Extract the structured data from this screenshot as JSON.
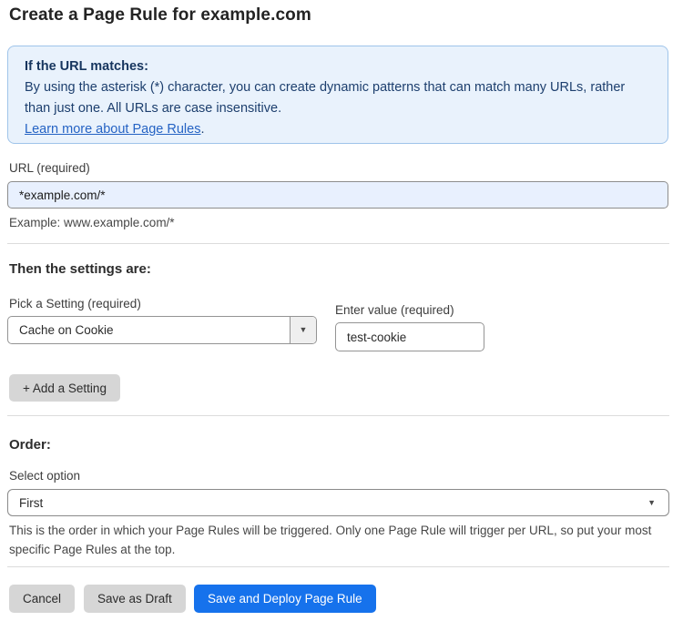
{
  "page": {
    "title": "Create a Page Rule for example.com"
  },
  "info_box": {
    "heading": "If the URL matches:",
    "body": "By using the asterisk (*) character, you can create dynamic patterns that can match many URLs, rather than just one. All URLs are case insensitive.",
    "link_text": "Learn more about Page Rules",
    "link_suffix": "."
  },
  "url_field": {
    "label": "URL (required)",
    "value": "*example.com/*",
    "example": "Example: www.example.com/*"
  },
  "settings_section": {
    "heading": "Then the settings are:",
    "setting_label": "Pick a Setting (required)",
    "setting_selected": "Cache on Cookie",
    "value_label": "Enter value (required)",
    "value_text": "test-cookie",
    "add_button_label": "+ Add a Setting"
  },
  "order_section": {
    "heading": "Order:",
    "select_label": "Select option",
    "selected": "First",
    "help": "This is the order in which your Page Rules will be triggered. Only one Page Rule will trigger per URL, so put your most specific Page Rules at the top."
  },
  "actions": {
    "cancel": "Cancel",
    "save_draft": "Save as Draft",
    "save_deploy": "Save and Deploy Page Rule"
  },
  "icons": {
    "dropdown_arrow": "▼"
  },
  "colors": {
    "primary_blue": "#1672ec",
    "info_bg": "#e9f2fc",
    "info_border": "#9fc4ea",
    "info_text": "#1d3f6e",
    "link_blue": "#2563c4",
    "autofill_input_bg": "#e8f0fe"
  }
}
